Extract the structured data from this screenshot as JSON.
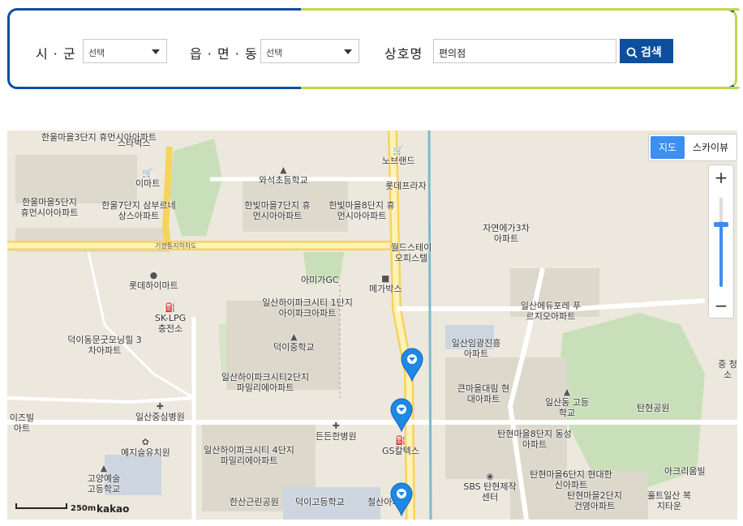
{
  "search": {
    "city_label": "시 · 군",
    "city_select_value": "선택",
    "town_label": "읍 · 면 · 동",
    "town_select_value": "선택",
    "store_label": "상호명",
    "store_input_value": "편의점",
    "search_button_label": "검색",
    "colors": {
      "primary": "#0b4f9e",
      "accent": "#c3d64a"
    }
  },
  "map": {
    "map_type": {
      "map_label": "지도",
      "skyview_label": "스카이뷰",
      "selected": "map"
    },
    "zoom": {
      "plus": "+",
      "minus": "−"
    },
    "scale_label": "250m",
    "provider": "kakao",
    "places": [
      "한울마을3단지 휴먼시아아파트",
      "스타벅스",
      "이마트",
      "와석초등학교",
      "노브랜드",
      "롯데프라자",
      "한울마을5단지 휴먼시아아파트",
      "한울7단지 삼부르네상스아파트",
      "한빛마을7단지 휴먼시아아파트",
      "한빛마을8단지 휴먼시아아파트",
      "자연에가3차 아파트",
      "월드스테이 오피스텔",
      "아미가GC",
      "메가박스",
      "롯데하이마트",
      "일산하이파크시티 1단지아이파크아파트",
      "일산에듀포레 푸르지오아파트",
      "SK-LPG 충전소",
      "덕이동문굿모닝힐 3차아파트",
      "덕이중학교",
      "일산임광진흥 아파트",
      "일산하이파크시티2단지 파밀리에아파트",
      "큰마을대림 현대아파트",
      "일산동 고등학교",
      "탄현공원",
      "일산중심병원",
      "든든한병원",
      "이즈빌 아트",
      "예지슬유치원",
      "탄현마을8단지 동성아파트",
      "GS칼텍스",
      "일산하이파크시티 4단지파밀리에아파트",
      "SBS 탄현제작센터",
      "탄현마을6단지 현대한신아파트",
      "아크리움빌",
      "고양예술 고등학교",
      "한산근린공원",
      "덕이고등학교",
      "철산아파트",
      "탄현마을2단지 건영아파트",
      "훌트일산 복지타운",
      "중 청소"
    ],
    "road_labels": [
      "기정동지하차도"
    ],
    "markers": [
      {
        "name": "convenience-store-marker-1",
        "color": "#1e88e5"
      },
      {
        "name": "convenience-store-marker-2",
        "color": "#1e88e5"
      },
      {
        "name": "convenience-store-marker-3",
        "color": "#1e88e5"
      }
    ]
  }
}
